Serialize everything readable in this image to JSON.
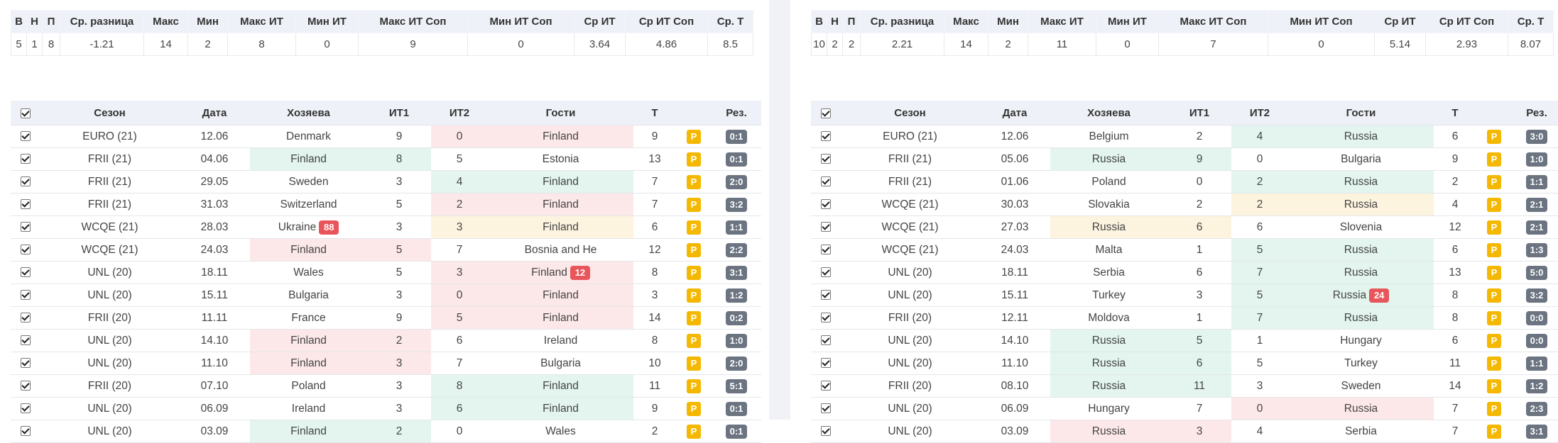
{
  "stats_headers": [
    "В",
    "Н",
    "П",
    "Ср. разница",
    "Макс",
    "Мин",
    "Макс ИТ",
    "Мин ИТ",
    "Макс ИТ Соп",
    "Мин ИТ Соп",
    "Ср ИТ",
    "Ср ИТ Соп",
    "Ср. Т"
  ],
  "match_headers": [
    "Сезон",
    "Дата",
    "Хозяева",
    "ИТ1",
    "ИТ2",
    "Гости",
    "Т",
    "Рез."
  ],
  "p_label": "P",
  "colors": {
    "green": "#e3f5ee",
    "red": "#fde8e9",
    "yellow": "#fdf4df",
    "p_badge": "#f5b800",
    "result_badge": "#6b7480",
    "red_badge": "#e8555a"
  },
  "left": {
    "stats": [
      "5",
      "1",
      "8",
      "-1.21",
      "14",
      "2",
      "8",
      "0",
      "9",
      "0",
      "3.64",
      "4.86",
      "8.5"
    ],
    "rows": [
      {
        "season": "EURO (21)",
        "date": "12.06",
        "home": "Denmark",
        "home_badge": "",
        "it1": "9",
        "it2": "0",
        "away": "Finland",
        "away_badge": "",
        "t": "9",
        "res": "0:1",
        "hl_home": "",
        "hl_away": "r"
      },
      {
        "season": "FRII (21)",
        "date": "04.06",
        "home": "Finland",
        "home_badge": "",
        "it1": "8",
        "it2": "5",
        "away": "Estonia",
        "away_badge": "",
        "t": "13",
        "res": "0:1",
        "hl_home": "g",
        "hl_away": ""
      },
      {
        "season": "FRII (21)",
        "date": "29.05",
        "home": "Sweden",
        "home_badge": "",
        "it1": "3",
        "it2": "4",
        "away": "Finland",
        "away_badge": "",
        "t": "7",
        "res": "2:0",
        "hl_home": "",
        "hl_away": "g"
      },
      {
        "season": "FRII (21)",
        "date": "31.03",
        "home": "Switzerland",
        "home_badge": "",
        "it1": "5",
        "it2": "2",
        "away": "Finland",
        "away_badge": "",
        "t": "7",
        "res": "3:2",
        "hl_home": "",
        "hl_away": "r"
      },
      {
        "season": "WCQE (21)",
        "date": "28.03",
        "home": "Ukraine",
        "home_badge": "88",
        "it1": "3",
        "it2": "3",
        "away": "Finland",
        "away_badge": "",
        "t": "6",
        "res": "1:1",
        "hl_home": "",
        "hl_away": "y"
      },
      {
        "season": "WCQE (21)",
        "date": "24.03",
        "home": "Finland",
        "home_badge": "",
        "it1": "5",
        "it2": "7",
        "away": "Bosnia and He",
        "away_badge": "",
        "t": "12",
        "res": "2:2",
        "hl_home": "r",
        "hl_away": ""
      },
      {
        "season": "UNL (20)",
        "date": "18.11",
        "home": "Wales",
        "home_badge": "",
        "it1": "5",
        "it2": "3",
        "away": "Finland",
        "away_badge": "12",
        "t": "8",
        "res": "3:1",
        "hl_home": "",
        "hl_away": "r"
      },
      {
        "season": "UNL (20)",
        "date": "15.11",
        "home": "Bulgaria",
        "home_badge": "",
        "it1": "3",
        "it2": "0",
        "away": "Finland",
        "away_badge": "",
        "t": "3",
        "res": "1:2",
        "hl_home": "",
        "hl_away": "r"
      },
      {
        "season": "FRII (20)",
        "date": "11.11",
        "home": "France",
        "home_badge": "",
        "it1": "9",
        "it2": "5",
        "away": "Finland",
        "away_badge": "",
        "t": "14",
        "res": "0:2",
        "hl_home": "",
        "hl_away": "r"
      },
      {
        "season": "UNL (20)",
        "date": "14.10",
        "home": "Finland",
        "home_badge": "",
        "it1": "2",
        "it2": "6",
        "away": "Ireland",
        "away_badge": "",
        "t": "8",
        "res": "1:0",
        "hl_home": "r",
        "hl_away": ""
      },
      {
        "season": "UNL (20)",
        "date": "11.10",
        "home": "Finland",
        "home_badge": "",
        "it1": "3",
        "it2": "7",
        "away": "Bulgaria",
        "away_badge": "",
        "t": "10",
        "res": "2:0",
        "hl_home": "r",
        "hl_away": ""
      },
      {
        "season": "FRII (20)",
        "date": "07.10",
        "home": "Poland",
        "home_badge": "",
        "it1": "3",
        "it2": "8",
        "away": "Finland",
        "away_badge": "",
        "t": "11",
        "res": "5:1",
        "hl_home": "",
        "hl_away": "g"
      },
      {
        "season": "UNL (20)",
        "date": "06.09",
        "home": "Ireland",
        "home_badge": "",
        "it1": "3",
        "it2": "6",
        "away": "Finland",
        "away_badge": "",
        "t": "9",
        "res": "0:1",
        "hl_home": "",
        "hl_away": "g"
      },
      {
        "season": "UNL (20)",
        "date": "03.09",
        "home": "Finland",
        "home_badge": "",
        "it1": "2",
        "it2": "0",
        "away": "Wales",
        "away_badge": "",
        "t": "2",
        "res": "0:1",
        "hl_home": "g",
        "hl_away": ""
      }
    ]
  },
  "right": {
    "stats": [
      "10",
      "2",
      "2",
      "2.21",
      "14",
      "2",
      "11",
      "0",
      "7",
      "0",
      "5.14",
      "2.93",
      "8.07"
    ],
    "rows": [
      {
        "season": "EURO (21)",
        "date": "12.06",
        "home": "Belgium",
        "home_badge": "",
        "it1": "2",
        "it2": "4",
        "away": "Russia",
        "away_badge": "",
        "t": "6",
        "res": "3:0",
        "hl_home": "",
        "hl_away": "g"
      },
      {
        "season": "FRII (21)",
        "date": "05.06",
        "home": "Russia",
        "home_badge": "",
        "it1": "9",
        "it2": "0",
        "away": "Bulgaria",
        "away_badge": "",
        "t": "9",
        "res": "1:0",
        "hl_home": "g",
        "hl_away": ""
      },
      {
        "season": "FRII (21)",
        "date": "01.06",
        "home": "Poland",
        "home_badge": "",
        "it1": "0",
        "it2": "2",
        "away": "Russia",
        "away_badge": "",
        "t": "2",
        "res": "1:1",
        "hl_home": "",
        "hl_away": "g"
      },
      {
        "season": "WCQE (21)",
        "date": "30.03",
        "home": "Slovakia",
        "home_badge": "",
        "it1": "2",
        "it2": "2",
        "away": "Russia",
        "away_badge": "",
        "t": "4",
        "res": "2:1",
        "hl_home": "",
        "hl_away": "y"
      },
      {
        "season": "WCQE (21)",
        "date": "27.03",
        "home": "Russia",
        "home_badge": "",
        "it1": "6",
        "it2": "6",
        "away": "Slovenia",
        "away_badge": "",
        "t": "12",
        "res": "2:1",
        "hl_home": "y",
        "hl_away": ""
      },
      {
        "season": "WCQE (21)",
        "date": "24.03",
        "home": "Malta",
        "home_badge": "",
        "it1": "1",
        "it2": "5",
        "away": "Russia",
        "away_badge": "",
        "t": "6",
        "res": "1:3",
        "hl_home": "",
        "hl_away": "g"
      },
      {
        "season": "UNL (20)",
        "date": "18.11",
        "home": "Serbia",
        "home_badge": "",
        "it1": "6",
        "it2": "7",
        "away": "Russia",
        "away_badge": "",
        "t": "13",
        "res": "5:0",
        "hl_home": "",
        "hl_away": "g"
      },
      {
        "season": "UNL (20)",
        "date": "15.11",
        "home": "Turkey",
        "home_badge": "",
        "it1": "3",
        "it2": "5",
        "away": "Russia",
        "away_badge": "24",
        "t": "8",
        "res": "3:2",
        "hl_home": "",
        "hl_away": "g"
      },
      {
        "season": "FRII (20)",
        "date": "12.11",
        "home": "Moldova",
        "home_badge": "",
        "it1": "1",
        "it2": "7",
        "away": "Russia",
        "away_badge": "",
        "t": "8",
        "res": "0:0",
        "hl_home": "",
        "hl_away": "g"
      },
      {
        "season": "UNL (20)",
        "date": "14.10",
        "home": "Russia",
        "home_badge": "",
        "it1": "5",
        "it2": "1",
        "away": "Hungary",
        "away_badge": "",
        "t": "6",
        "res": "0:0",
        "hl_home": "g",
        "hl_away": ""
      },
      {
        "season": "UNL (20)",
        "date": "11.10",
        "home": "Russia",
        "home_badge": "",
        "it1": "6",
        "it2": "5",
        "away": "Turkey",
        "away_badge": "",
        "t": "11",
        "res": "1:1",
        "hl_home": "g",
        "hl_away": ""
      },
      {
        "season": "FRII (20)",
        "date": "08.10",
        "home": "Russia",
        "home_badge": "",
        "it1": "11",
        "it2": "3",
        "away": "Sweden",
        "away_badge": "",
        "t": "14",
        "res": "1:2",
        "hl_home": "g",
        "hl_away": ""
      },
      {
        "season": "UNL (20)",
        "date": "06.09",
        "home": "Hungary",
        "home_badge": "",
        "it1": "7",
        "it2": "0",
        "away": "Russia",
        "away_badge": "",
        "t": "7",
        "res": "2:3",
        "hl_home": "",
        "hl_away": "r"
      },
      {
        "season": "UNL (20)",
        "date": "03.09",
        "home": "Russia",
        "home_badge": "",
        "it1": "3",
        "it2": "4",
        "away": "Serbia",
        "away_badge": "",
        "t": "7",
        "res": "3:1",
        "hl_home": "r",
        "hl_away": ""
      }
    ]
  }
}
